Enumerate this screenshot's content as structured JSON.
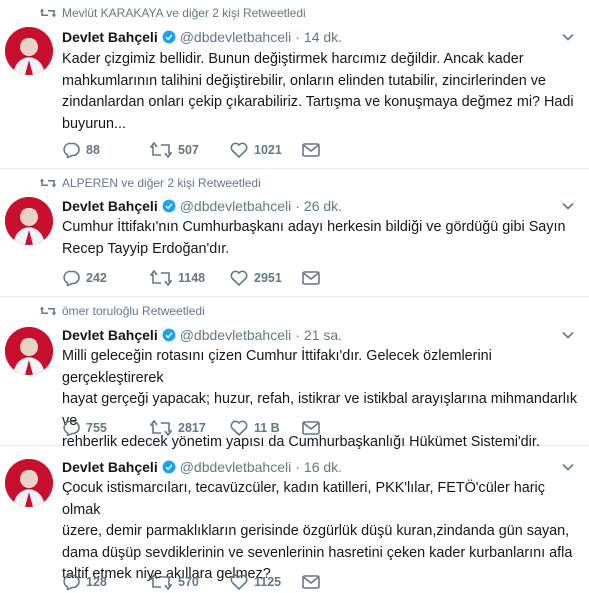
{
  "colors": {
    "text": "#14171a",
    "muted": "#657786",
    "verified": "#1da1f2",
    "divider": "#e6ecf0",
    "avatar_red": "#c8102e"
  },
  "icons": [
    "retweet-icon",
    "verified-badge-icon",
    "chevron-down-icon",
    "reply-icon",
    "like-icon",
    "direct-message-icon"
  ],
  "tweets": [
    {
      "context": "Mevlüt KARAKAYA ve diğer 2 kişi Retweetledi",
      "name": "Devlet Bahçeli",
      "handle": "@dbdevletbahceli",
      "separator": "·",
      "time": "14 dk.",
      "text": "Kader çizgimiz bellidir. Bunun değiştirmek harcımız değildir. Ancak kader\nmahkumlarının talihini değiştirebilir, onların elinden tutabilir, zincirlerinden ve\nzindanlardan onları çekip çıkarabiliriz. Tartışma ve konuşmaya değmez mi? Hadi\nbuyurun...",
      "replies": "88",
      "retweets": "507",
      "likes": "1021"
    },
    {
      "context": "ALPEREN ve diğer 2 kişi Retweetledi",
      "name": "Devlet Bahçeli",
      "handle": "@dbdevletbahceli",
      "separator": "·",
      "time": "26 dk.",
      "text": "Cumhur İttifakı'nın Cumhurbaşkanı adayı herkesin bildiği ve gördüğü gibi Sayın\nRecep Tayyip Erdoğan'dır.",
      "replies": "242",
      "retweets": "1148",
      "likes": "2951"
    },
    {
      "context": "ömer toruloğlu Retweetledi",
      "name": "Devlet Bahçeli",
      "handle": "@dbdevletbahceli",
      "separator": "·",
      "time": "21 sa.",
      "text": "Milli geleceğin rotasını çizen Cumhur İttifakı'dır. Gelecek özlemlerini gerçekleştirerek\nhayat gerçeği yapacak; huzur, refah, istikrar ve istikbal arayışlarına mihmandarlık ve\nrehberlik edecek yönetim yapısı da Cumhurbaşkanlığı Hükümet Sistemi'dir.",
      "replies": "755",
      "retweets": "2817",
      "likes": "11 B"
    },
    {
      "context": "",
      "name": "Devlet Bahçeli",
      "handle": "@dbdevletbahceli",
      "separator": "·",
      "time": "16 dk.",
      "text": "Çocuk istismarcıları, tecavüzcüler, kadın katilleri, PKK'lılar, FETÖ'cüler hariç olmak\nüzere, demir parmaklıkların gerisinde özgürlük düşü kuran,zindanda gün sayan,\ndama düşüp sevdiklerinin ve sevenlerinin hasretini çeken kader kurbanlarını afla\ntaltif etmek niye akıllara gelmez?",
      "replies": "128",
      "retweets": "570",
      "likes": "1125"
    }
  ]
}
